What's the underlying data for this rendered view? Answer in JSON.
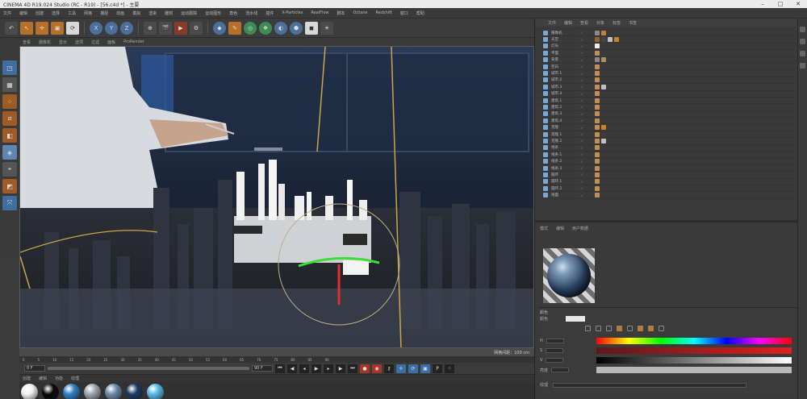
{
  "app": {
    "title": "CINEMA 4D R19.024 Studio (RC - R19) - [56.c4d *] - 主要",
    "window_controls": [
      "–",
      "□",
      "✕"
    ]
  },
  "menubar": {
    "items": [
      "文件",
      "编辑",
      "创建",
      "选择",
      "工具",
      "网格",
      "捕捉",
      "动画",
      "模拟",
      "渲染",
      "雕刻",
      "运动跟踪",
      "运动图形",
      "角色",
      "流水线",
      "插件",
      "X-Particles",
      "RealFlow",
      "脚本",
      "Octane",
      "Redshift",
      "窗口",
      "帮助"
    ]
  },
  "toolbar": {
    "icons": [
      {
        "name": "undo-icon",
        "glyph": "↶",
        "style": ""
      },
      {
        "name": "live-select-icon",
        "glyph": "↖",
        "style": "orange"
      },
      {
        "name": "move-icon",
        "glyph": "✛",
        "style": "orange"
      },
      {
        "name": "scale-icon",
        "glyph": "▣",
        "style": "orange"
      },
      {
        "name": "rotate-icon",
        "glyph": "⟳",
        "style": "white"
      },
      {
        "name": "x-axis-icon",
        "glyph": "X",
        "style": "blue"
      },
      {
        "name": "y-axis-icon",
        "glyph": "Y",
        "style": "blue"
      },
      {
        "name": "z-axis-icon",
        "glyph": "Z",
        "style": "blue"
      },
      {
        "name": "coordinate-system-icon",
        "glyph": "⊕",
        "style": ""
      },
      {
        "name": "render-view-icon",
        "glyph": "🎬",
        "style": ""
      },
      {
        "name": "render-picture-viewer-icon",
        "glyph": "▶",
        "style": "red"
      },
      {
        "name": "render-settings-icon",
        "glyph": "⚙",
        "style": ""
      },
      {
        "name": "cube-icon",
        "glyph": "◆",
        "style": "blue"
      },
      {
        "name": "pen-icon",
        "glyph": "✎",
        "style": "orange"
      },
      {
        "name": "subdivision-icon",
        "glyph": "◎",
        "style": "green"
      },
      {
        "name": "array-icon",
        "glyph": "❖",
        "style": "green"
      },
      {
        "name": "deformer-icon",
        "glyph": "◐",
        "style": "blue"
      },
      {
        "name": "scene-icon",
        "glyph": "⬢",
        "style": "blue"
      },
      {
        "name": "camera-icon",
        "glyph": "◼",
        "style": "white"
      },
      {
        "name": "light-icon",
        "glyph": "☀",
        "style": ""
      }
    ]
  },
  "viewport": {
    "menu": [
      "查看",
      "摄像机",
      "显示",
      "选项",
      "过滤",
      "面板",
      "ProRender"
    ],
    "status": "网格间距：100 cm"
  },
  "timeline": {
    "ticks": [
      "0",
      "5",
      "10",
      "15",
      "20",
      "25",
      "30",
      "35",
      "40",
      "45",
      "50",
      "55",
      "60",
      "65",
      "70",
      "75",
      "80",
      "85",
      "90"
    ],
    "current": "0 F",
    "start": "0 F",
    "end": "90 F"
  },
  "material_manager": {
    "menu": [
      "创建",
      "编辑",
      "功能",
      "纹理"
    ],
    "materials": [
      {
        "name": "mat-white",
        "color": "#f2f2f2"
      },
      {
        "name": "mat-black",
        "color": "#0a0a0a"
      },
      {
        "name": "mat-blue",
        "color": "#2d7fc0"
      },
      {
        "name": "mat-grey",
        "color": "#9aa3ab"
      },
      {
        "name": "mat-glass",
        "color": "#6b8aa8"
      },
      {
        "name": "mat-dark-blue",
        "color": "#1d3a63"
      },
      {
        "name": "mat-cyan",
        "color": "#59b8e6"
      }
    ]
  },
  "object_manager": {
    "tabs": [
      "文件",
      "编辑",
      "查看",
      "对象",
      "标签",
      "书签"
    ],
    "rows": [
      {
        "label": "摄像机",
        "tags": [
          "#8a8a8a",
          "#c08040"
        ]
      },
      {
        "label": "天空",
        "tags": [
          "#9a6030",
          "#444444",
          "#c0c0c0",
          "#d08020"
        ]
      },
      {
        "label": "灯光",
        "tags": [
          "#eeeeee"
        ]
      },
      {
        "label": "平面",
        "tags": [
          "#c09050"
        ]
      },
      {
        "label": "背景",
        "tags": [
          "#8a8a8a",
          "#b09060"
        ]
      },
      {
        "label": "空白",
        "tags": [
          "#c09050"
        ]
      },
      {
        "label": "城市.1",
        "tags": [
          "#c09050"
        ]
      },
      {
        "label": "城市.2",
        "tags": [
          "#c09050"
        ]
      },
      {
        "label": "城市.3",
        "tags": [
          "#c09050",
          "#c0c0c0"
        ]
      },
      {
        "label": "城市.4",
        "tags": [
          "#c09050"
        ]
      },
      {
        "label": "建筑.1",
        "tags": [
          "#c09050"
        ]
      },
      {
        "label": "建筑.2",
        "tags": [
          "#c09050"
        ]
      },
      {
        "label": "建筑.3",
        "tags": [
          "#c09050"
        ]
      },
      {
        "label": "建筑.4",
        "tags": [
          "#c09050"
        ]
      },
      {
        "label": "克隆",
        "tags": [
          "#c09050",
          "#d08020"
        ]
      },
      {
        "label": "克隆.1",
        "tags": [
          "#c09050"
        ]
      },
      {
        "label": "克隆.2",
        "tags": [
          "#c09050",
          "#c0c0c0"
        ]
      },
      {
        "label": "线条",
        "tags": [
          "#c09050"
        ]
      },
      {
        "label": "线条.1",
        "tags": [
          "#c09050"
        ]
      },
      {
        "label": "线条.2",
        "tags": [
          "#c09050"
        ]
      },
      {
        "label": "线条.3",
        "tags": [
          "#c09050"
        ]
      },
      {
        "label": "圆环",
        "tags": [
          "#c09050"
        ]
      },
      {
        "label": "圆环.1",
        "tags": [
          "#c09050"
        ]
      },
      {
        "label": "圆环.2",
        "tags": [
          "#c09050"
        ]
      },
      {
        "label": "地面",
        "tags": [
          "#c09050"
        ]
      }
    ]
  },
  "attributes": {
    "tabs": [
      "模式",
      "编辑",
      "用户数据"
    ],
    "section_label": "颜色",
    "color_label": "颜色",
    "rows": [
      "H",
      "S",
      "V",
      "亮度"
    ],
    "footer_label": "纹理"
  }
}
